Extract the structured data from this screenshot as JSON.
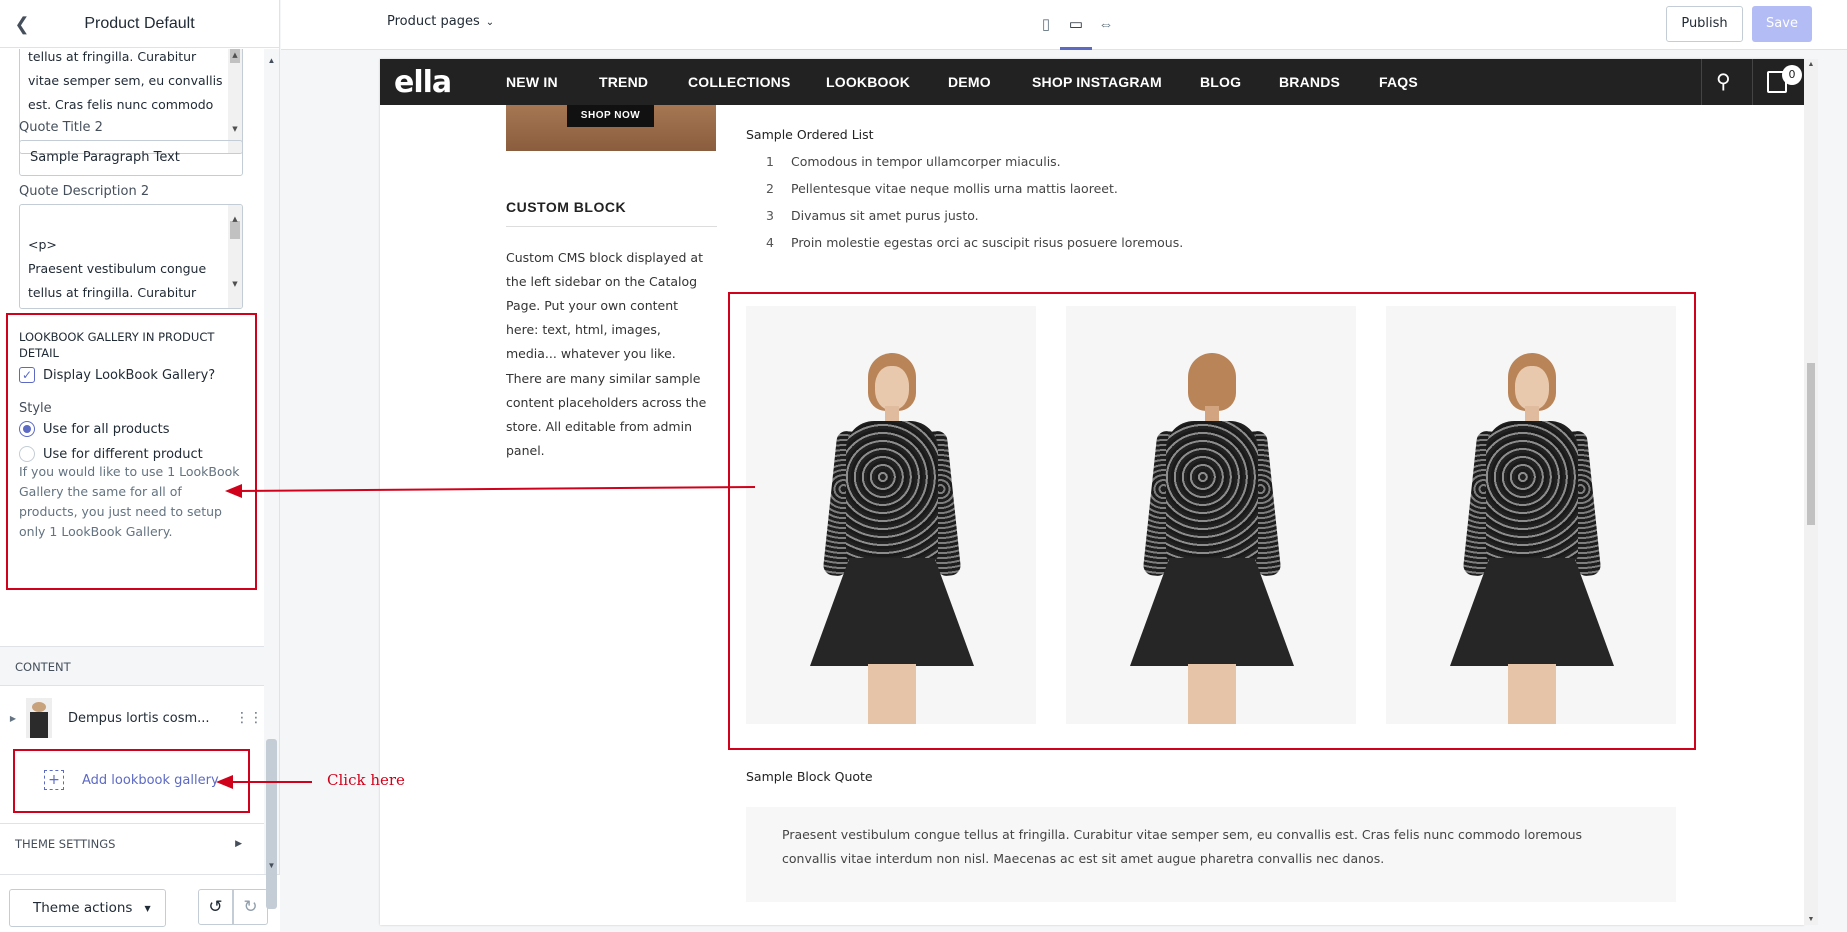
{
  "sidebar": {
    "title": "Product Default",
    "quote_desc_1_visible": "tellus at fringilla. Curabitur vitae semper sem, eu convallis est. Cras felis nunc commodo",
    "quote_title_2_label": "Quote Title 2",
    "quote_title_2_value": "Sample Paragraph Text",
    "quote_desc_2_label": "Quote Description 2",
    "quote_desc_2_value": "<p>\nPraesent vestibulum congue tellus at fringilla. Curabitur vitae semper sem, eu convallis",
    "lookbook_section_title": "LOOKBOOK GALLERY IN PRODUCT DETAIL",
    "display_checkbox_label": "Display LookBook Gallery?",
    "display_checkbox_checked": true,
    "style_label": "Style",
    "style_options": [
      {
        "label": "Use for all products",
        "selected": true
      },
      {
        "label": "Use for different product",
        "selected": false
      }
    ],
    "help_text": "If you would like to use 1 LookBook Gallery the same for all of products, you just need to setup only 1 LookBook Gallery.",
    "content_header": "CONTENT",
    "block_name": "Dempus lortis cosm...",
    "add_block_label": "Add lookbook gallery",
    "theme_settings_label": "THEME SETTINGS",
    "theme_actions_label": "Theme actions"
  },
  "topbar": {
    "page_selector": "Product pages",
    "publish_label": "Publish",
    "save_label": "Save"
  },
  "store": {
    "logo": "ella",
    "nav": [
      "NEW IN",
      "TREND",
      "COLLECTIONS",
      "LOOKBOOK",
      "DEMO",
      "SHOP INSTAGRAM",
      "BLOG",
      "BRANDS",
      "FAQS"
    ],
    "cart_count": "0",
    "promo_button": "SHOP NOW",
    "custom_block_title": "CUSTOM BLOCK",
    "custom_block_p1": "Custom CMS block displayed at the left sidebar on the Catalog Page. Put your own content here: text, html, images, media... whatever you like.",
    "custom_block_p2": "There are many similar sample content placeholders across the store. All editable from admin panel.",
    "ordered_list_title": "Sample Ordered List",
    "ordered_list": [
      {
        "num": "1",
        "text": "Comodous in tempor ullamcorper miaculis."
      },
      {
        "num": "2",
        "text": "Pellentesque vitae neque mollis urna mattis laoreet."
      },
      {
        "num": "3",
        "text": "Divamus sit amet purus justo."
      },
      {
        "num": "4",
        "text": "Proin molestie egestas orci ac suscipit risus posuere loremous."
      }
    ],
    "block_quote_title": "Sample Block Quote",
    "block_quote_text": "Praesent vestibulum congue tellus at fringilla. Curabitur vitae semper sem, eu convallis est. Cras felis nunc commodo loremous convallis vitae interdum non nisl. Maecenas ac est sit amet augue pharetra convallis nec danos."
  },
  "annotation": {
    "click_here": "Click here",
    "color": "#d0021b"
  }
}
